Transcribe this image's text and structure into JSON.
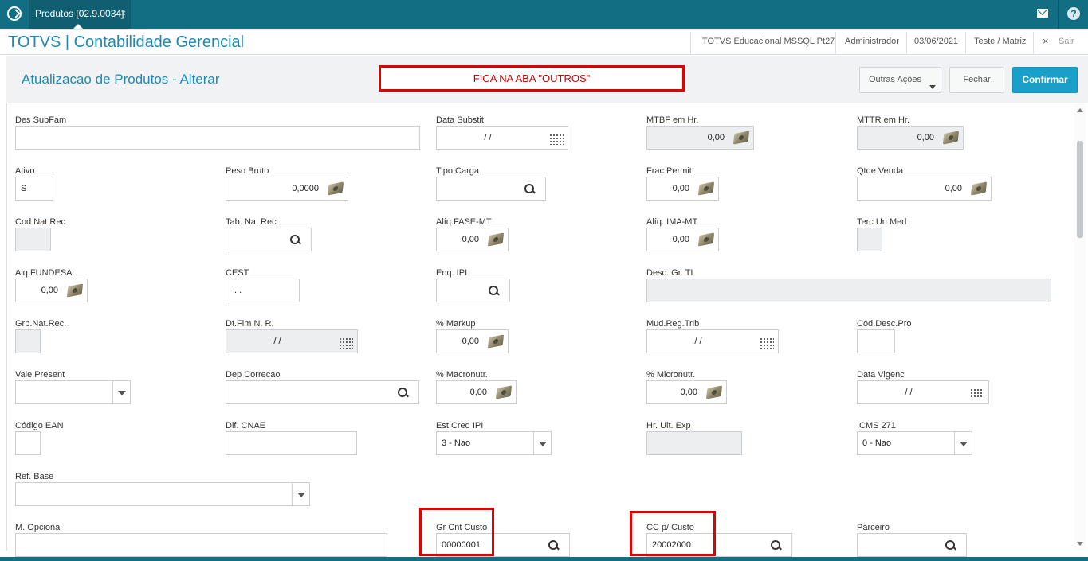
{
  "topbar": {
    "tab_label": "Produtos [02.9.0034]",
    "tab_close": "×"
  },
  "appbar": {
    "title": "TOTVS | Contabilidade Gerencial",
    "environment": "TOTVS Educacional MSSQL Pt27",
    "user": "Administrador",
    "date": "03/06/2021",
    "branch": "Teste / Matriz",
    "exit_label": "Sair",
    "exit_icon": "×"
  },
  "header": {
    "page_title": "Atualizacao de Produtos - Alterar",
    "annotation": "FICA NA ABA \"OUTROS\"",
    "more_actions": "Outras Ações",
    "close": "Fechar",
    "confirm": "Confirmar"
  },
  "colors": {
    "topbar": "#126e82",
    "accent": "#1b8bb6",
    "confirm": "#1aa0c8",
    "annotation_red": "#e00000"
  },
  "form": {
    "des_subfam": {
      "label": "Des SubFam",
      "value": ""
    },
    "data_substit": {
      "label": "Data Substit",
      "value": "/ /"
    },
    "mtbf": {
      "label": "MTBF em Hr.",
      "value": "0,00"
    },
    "mttr": {
      "label": "MTTR em Hr.",
      "value": "0,00"
    },
    "ativo": {
      "label": "Ativo",
      "value": "S"
    },
    "peso_bruto": {
      "label": "Peso Bruto",
      "value": "0,0000"
    },
    "tipo_carga": {
      "label": "Tipo Carga",
      "value": ""
    },
    "frac_permit": {
      "label": "Frac Permit",
      "value": "0,00"
    },
    "qtde_venda": {
      "label": "Qtde Venda",
      "value": "0,00"
    },
    "cod_nat_rec": {
      "label": "Cod Nat Rec",
      "value": ""
    },
    "tab_na_rec": {
      "label": "Tab. Na. Rec",
      "value": ""
    },
    "aliq_fase": {
      "label": "Alíq.FASE-MT",
      "value": "0,00"
    },
    "aliq_ima": {
      "label": "Alíq. IMA-MT",
      "value": "0,00"
    },
    "terc_un_med": {
      "label": "Terc Un Med",
      "value": ""
    },
    "alq_fundesa": {
      "label": "Alq.FUNDESA",
      "value": "0,00"
    },
    "cest": {
      "label": "CEST",
      "value": ". ."
    },
    "enq_ipi": {
      "label": "Enq. IPI",
      "value": ""
    },
    "desc_gr_ti": {
      "label": "Desc. Gr. TI",
      "value": ""
    },
    "grp_nat_rec": {
      "label": "Grp.Nat.Rec.",
      "value": ""
    },
    "dt_fim_nr": {
      "label": "Dt.Fim N. R.",
      "value": "/ /"
    },
    "markup": {
      "label": "% Markup",
      "value": "0,00"
    },
    "mud_reg_trib": {
      "label": "Mud.Reg.Trib",
      "value": "/ /"
    },
    "cod_desc_pro": {
      "label": "Cód.Desc.Pro",
      "value": ""
    },
    "vale_present": {
      "label": "Vale Present",
      "value": ""
    },
    "dep_correcao": {
      "label": "Dep Correcao",
      "value": ""
    },
    "macronutr": {
      "label": "% Macronutr.",
      "value": "0,00"
    },
    "micronutr": {
      "label": "% Micronutr.",
      "value": "0,00"
    },
    "data_vigenc": {
      "label": "Data Vigenc",
      "value": "/ /"
    },
    "codigo_ean": {
      "label": "Código EAN",
      "value": ""
    },
    "dif_cnae": {
      "label": "Dif. CNAE",
      "value": ""
    },
    "est_cred_ipi": {
      "label": "Est Cred IPI",
      "value": "3 - Nao"
    },
    "hr_ult_exp": {
      "label": "Hr. Ult. Exp",
      "value": ""
    },
    "icms_271": {
      "label": "ICMS 271",
      "value": "0 - Nao"
    },
    "ref_base": {
      "label": "Ref. Base",
      "value": ""
    },
    "m_opcional": {
      "label": "M. Opcional",
      "value": ""
    },
    "gr_cnt_custo": {
      "label": "Gr Cnt Custo",
      "value": "00000001"
    },
    "cc_custo": {
      "label": "CC p/ Custo",
      "value": "20002000"
    },
    "parceiro": {
      "label": "Parceiro",
      "value": ""
    }
  }
}
